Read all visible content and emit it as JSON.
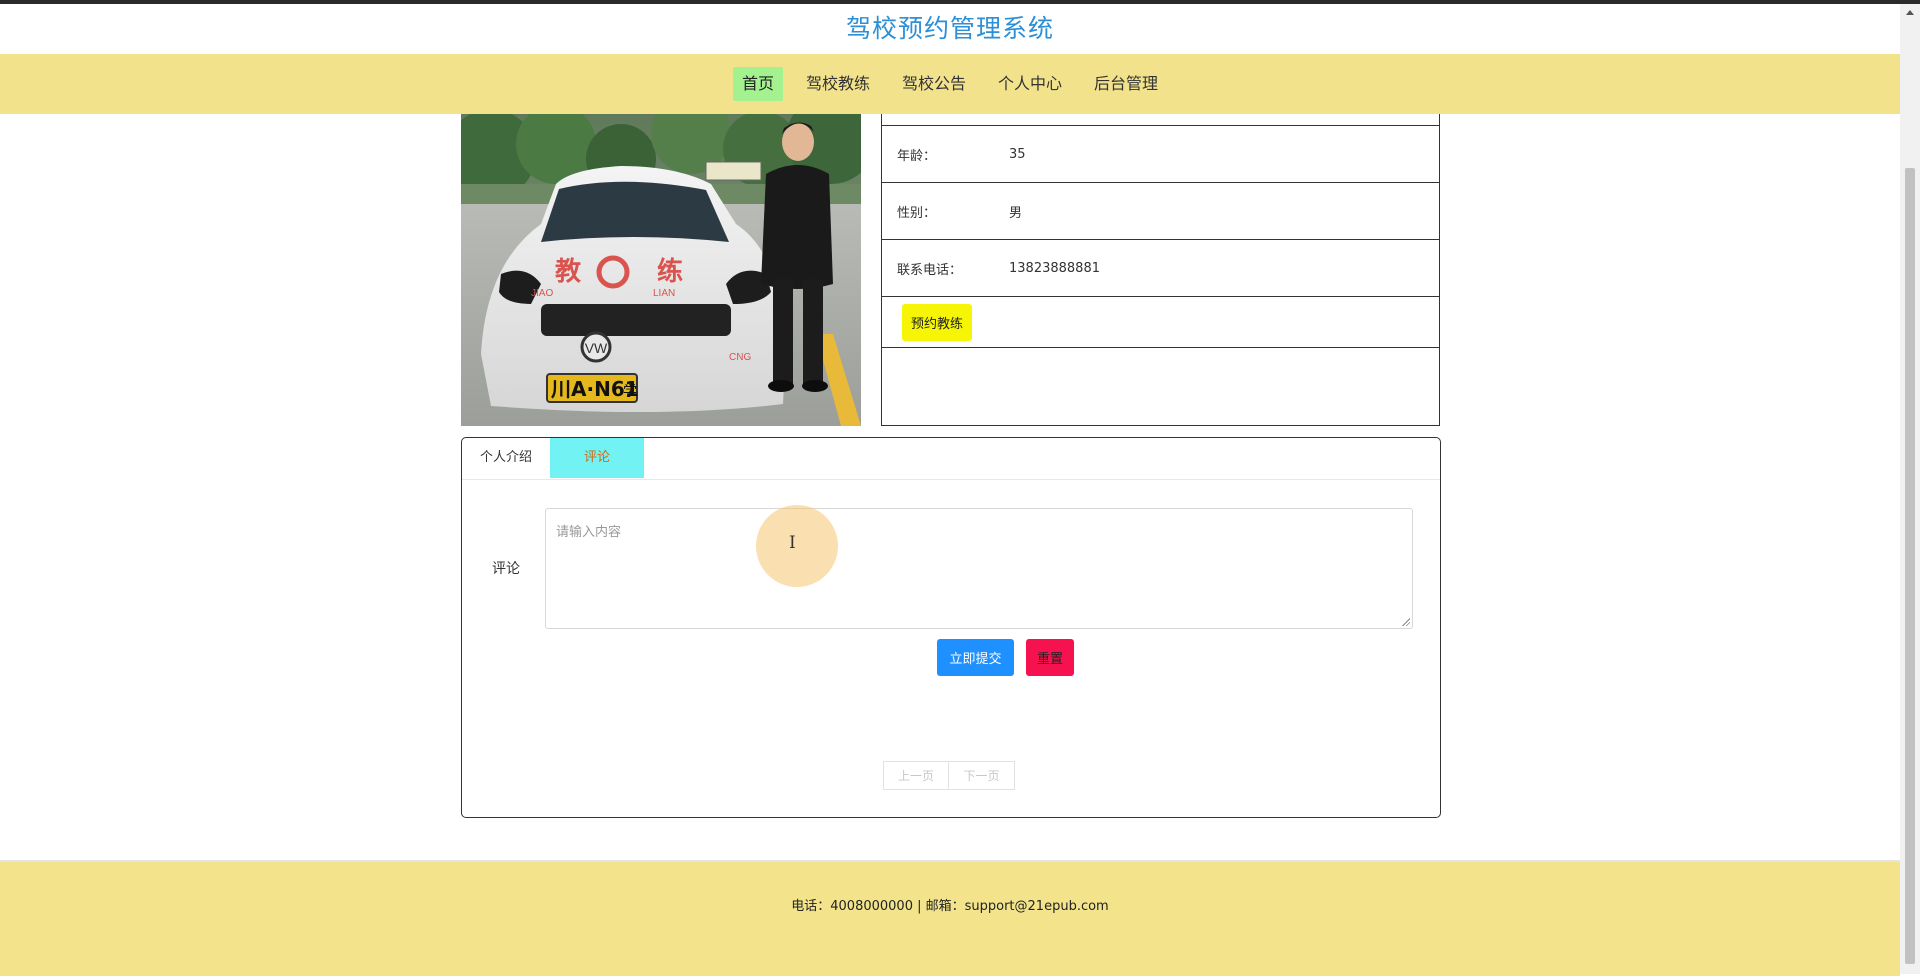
{
  "header": {
    "title": "驾校预约管理系统"
  },
  "nav": {
    "items": [
      {
        "label": "首页",
        "active": true
      },
      {
        "label": "驾校教练"
      },
      {
        "label": "驾校公告"
      },
      {
        "label": "个人中心"
      },
      {
        "label": "后台管理"
      }
    ]
  },
  "photo": {
    "plate": "川A·N61",
    "plate_suffix": "学",
    "car_text_left": "教",
    "car_text_right": "练",
    "car_sub_left": "JIAO",
    "car_sub_right": "LIAN",
    "badge": "CNG"
  },
  "info": {
    "age_label": "年龄：",
    "age_value": "35",
    "gender_label": "性别：",
    "gender_value": "男",
    "phone_label": "联系电话：",
    "phone_value": "13823888881",
    "book_button": "预约教练"
  },
  "tabs": [
    {
      "label": "个人介绍"
    },
    {
      "label": "评论",
      "active": true
    }
  ],
  "comment_form": {
    "label": "评论",
    "placeholder": "请输入内容",
    "cursor_glyph": "I",
    "submit": "立即提交",
    "reset": "重置"
  },
  "pager": {
    "prev": "上一页",
    "next": "下一页"
  },
  "footer": {
    "text": "电话：4008000000 | 邮箱：support@21epub.com"
  },
  "colors": {
    "nav_bg": "#f2e28c",
    "nav_active": "#a4f28f",
    "title": "#2d8fd6",
    "tab_active": "#72f2f2",
    "book_button": "#f5f505",
    "submit": "#1e90ff",
    "reset": "#f5124e"
  }
}
